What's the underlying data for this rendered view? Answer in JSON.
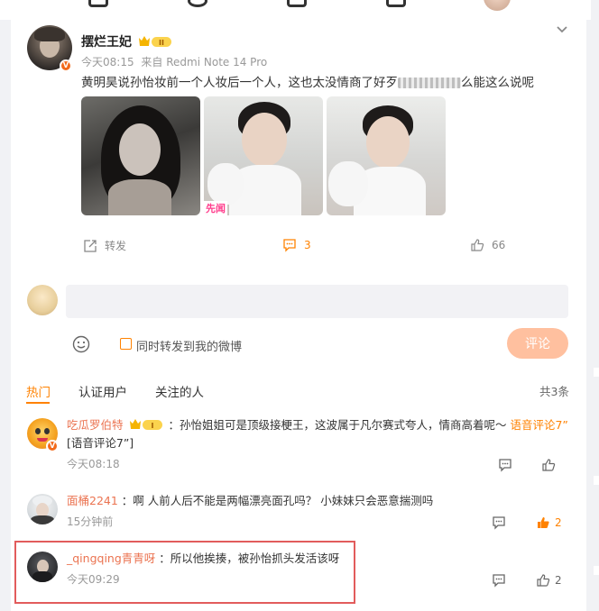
{
  "post": {
    "author": "摆烂王妃",
    "level_badge": "II",
    "time": "今天08:15",
    "source": "来自 Redmi Note 14 Pro",
    "text_before": "黄明昊说孙怡妆前一个人妆后一个人，这也太没情商了好歹",
    "text_after": "么能这么说呢",
    "image_watermark": "先闻",
    "actions": {
      "repost_label": "转发",
      "comment_count": "3",
      "like_count": "66"
    }
  },
  "composer": {
    "placeholder": "",
    "repost_checkbox_label": "同时转发到我的微博",
    "submit_label": "评论"
  },
  "comment_tabs": {
    "tabs": [
      "热门",
      "认证用户",
      "关注的人"
    ],
    "total": "共3条"
  },
  "comments": [
    {
      "name": "吃瓜罗伯特",
      "badge": "I",
      "text": "：孙怡姐姐可是顶级接梗王，这波属于凡尔赛式夸人，情商高着呢～",
      "link": "语音评论7”",
      "text_tail": "[语音评论7”]",
      "time": "今天08:18",
      "likes": ""
    },
    {
      "name": "面桶2241",
      "text": "：啊 人前人后不能是两幅漂亮面孔吗？ 小妹妹只会恶意揣测吗",
      "time": "15分钟前",
      "likes": "2"
    },
    {
      "name": "_qingqing青青呀",
      "text": "：所以他挨揍，被孙怡抓头发活该呀",
      "time": "今天09:29",
      "likes": "2"
    }
  ],
  "icons": {
    "collapse": "chevron-down-icon",
    "repost": "share-icon",
    "comment": "comment-icon",
    "like": "thumb-up-icon",
    "emoji": "smiley-icon"
  },
  "colors": {
    "accent": "#ff8200",
    "username": "#eb7350",
    "highlight_border": "#e25c5c",
    "submit_disabled": "#ffc09f"
  }
}
